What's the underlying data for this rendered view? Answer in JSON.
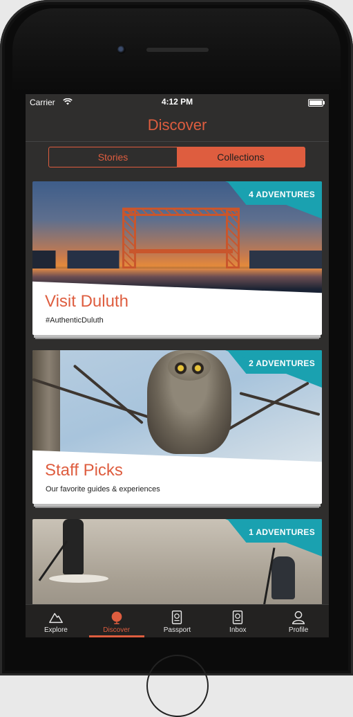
{
  "status": {
    "carrier": "Carrier",
    "time": "4:12 PM"
  },
  "header": {
    "title": "Discover"
  },
  "segments": {
    "stories": "Stories",
    "collections": "Collections",
    "selected": "Collections"
  },
  "cards": [
    {
      "title": "Visit Duluth",
      "subtitle": "#AuthenticDuluth",
      "badge": "4 ADVENTURES"
    },
    {
      "title": "Staff Picks",
      "subtitle": "Our favorite guides & experiences",
      "badge": "2 ADVENTURES"
    },
    {
      "title": "",
      "subtitle": "",
      "badge": "1 ADVENTURES"
    }
  ],
  "tabs": [
    {
      "label": "Explore",
      "icon": "mountain-icon"
    },
    {
      "label": "Discover",
      "icon": "globe-icon",
      "active": true
    },
    {
      "label": "Passport",
      "icon": "passport-icon"
    },
    {
      "label": "Inbox",
      "icon": "inbox-icon"
    },
    {
      "label": "Profile",
      "icon": "profile-icon"
    }
  ],
  "colors": {
    "accent": "#de5d3f",
    "badge": "#1aa1b0",
    "background": "#2f2e2d"
  }
}
